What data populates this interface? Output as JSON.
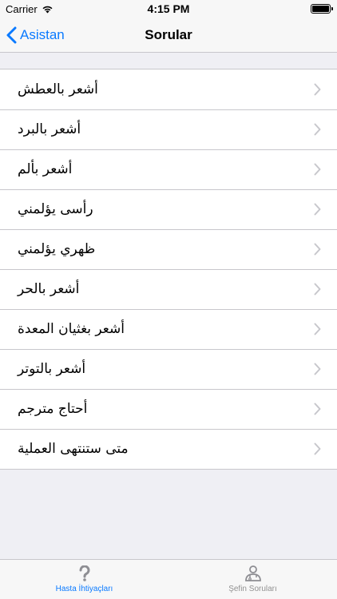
{
  "status_bar": {
    "carrier": "Carrier",
    "time": "4:15 PM"
  },
  "nav": {
    "back_label": "Asistan",
    "title": "Sorular"
  },
  "questions": [
    {
      "label": "أشعر بالعطش"
    },
    {
      "label": "أشعر بالبرد"
    },
    {
      "label": "أشعر بألم"
    },
    {
      "label": "رأسى يؤلمني"
    },
    {
      "label": "ظهري يؤلمني"
    },
    {
      "label": "أشعر بالحر"
    },
    {
      "label": "أشعر بغثيان المعدة"
    },
    {
      "label": "أشعر بالتوتر"
    },
    {
      "label": "أحتاج مترجم"
    },
    {
      "label": "متى ستنتهى العملية"
    }
  ],
  "tabs": [
    {
      "label": "Hasta İhtiyaçları",
      "icon": "question-icon",
      "active": true
    },
    {
      "label": "Şefin Soruları",
      "icon": "doctor-icon",
      "active": false
    }
  ],
  "colors": {
    "accent": "#0a7aff",
    "inactive": "#929292",
    "background": "#efeff4",
    "separator": "#c8c7cc"
  }
}
